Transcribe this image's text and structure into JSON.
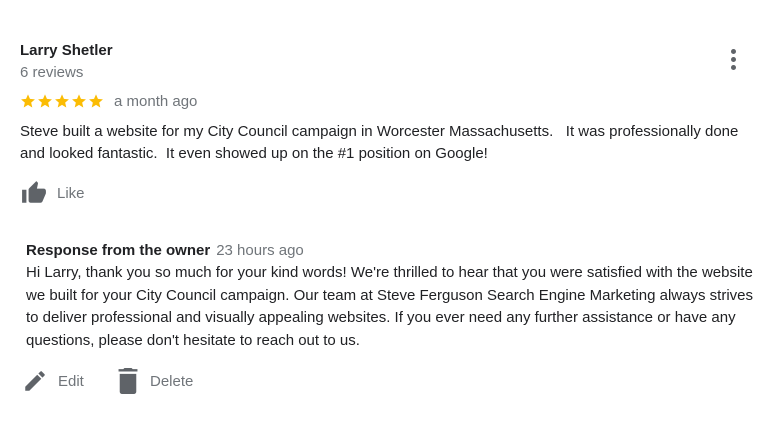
{
  "review": {
    "reviewer_name": "Larry Shetler",
    "reviewer_reviews": "6 reviews",
    "rating": 5,
    "rating_max": 5,
    "date": "a month ago",
    "text": "Steve built a website for my City Council campaign in Worcester Massachusetts.   It was professionally done and looked fantastic.  It even showed up on the #1 position on Google!",
    "like_label": "Like",
    "more_icon": "more-vert-icon"
  },
  "owner_response": {
    "title": "Response from the owner",
    "time": "23 hours ago",
    "text": "Hi Larry, thank you so much for your kind words! We're thrilled to hear that you were satisfied with the website we built for your City Council campaign. Our team at Steve Ferguson Search Engine Marketing always strives to deliver professional and visually appealing websites. If you ever need any further assistance or have any questions, please don't hesitate to reach out to us."
  },
  "actions": {
    "edit_label": "Edit",
    "delete_label": "Delete"
  },
  "icons": {
    "star": "star-icon",
    "like": "thumb-up-icon",
    "edit": "pencil-icon",
    "delete": "trash-icon"
  },
  "colors": {
    "star": "#fbbc04",
    "icon": "#5f6368",
    "muted_text": "#70757a",
    "text": "#202124"
  }
}
